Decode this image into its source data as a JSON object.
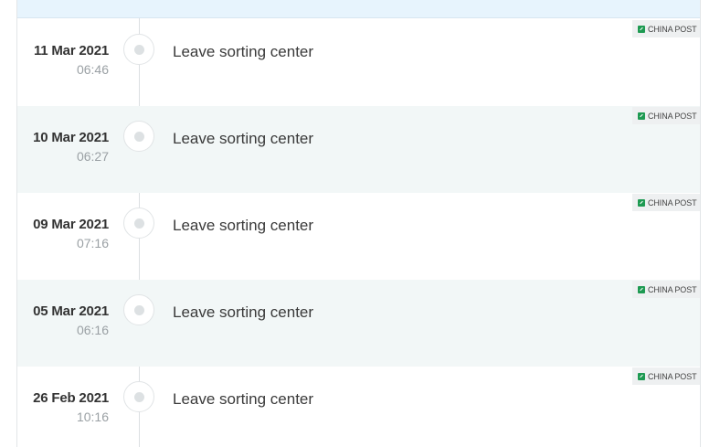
{
  "events": [
    {
      "date": "11 Mar 2021",
      "time": "06:46",
      "description": "Leave sorting center",
      "carrier": "CHINA POST"
    },
    {
      "date": "10 Mar 2021",
      "time": "06:27",
      "description": "Leave sorting center",
      "carrier": "CHINA POST"
    },
    {
      "date": "09 Mar 2021",
      "time": "07:16",
      "description": "Leave sorting center",
      "carrier": "CHINA POST"
    },
    {
      "date": "05 Mar 2021",
      "time": "06:16",
      "description": "Leave sorting center",
      "carrier": "CHINA POST"
    },
    {
      "date": "26 Feb 2021",
      "time": "10:16",
      "description": "Leave sorting center",
      "carrier": "CHINA POST"
    }
  ],
  "colors": {
    "header_band": "#e7f4fd",
    "alt_row": "#f2f7f7",
    "carrier_icon": "#1e9a52"
  },
  "icons": {
    "carrier": "china-post-logo-icon",
    "timeline_marker": "timeline-dot-icon"
  }
}
